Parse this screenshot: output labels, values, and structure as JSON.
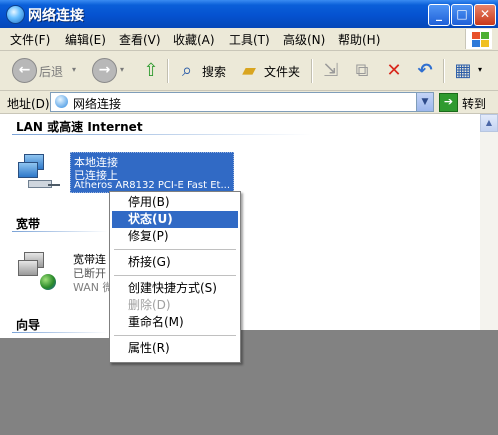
{
  "window": {
    "title": "网络连接"
  },
  "menu": [
    "文件(F)",
    "编辑(E)",
    "查看(V)",
    "收藏(A)",
    "工具(T)",
    "高级(N)",
    "帮助(H)"
  ],
  "toolbar": {
    "back": "后退",
    "search": "搜索",
    "folders": "文件夹"
  },
  "address": {
    "label": "地址(D)",
    "value": "网络连接",
    "go": "转到"
  },
  "groups": {
    "lan": {
      "header": "LAN 或高速 Internet"
    },
    "broadband": {
      "header": "宽带"
    },
    "wizard": {
      "header": "向导"
    }
  },
  "connections": {
    "lan": {
      "name": "本地连接",
      "status": "已连接上",
      "device": "Atheros AR8132 PCI-E Fast Et..."
    },
    "broadband": {
      "name": "宽带连",
      "status": "已断开",
      "device": "WAN 微"
    }
  },
  "context_menu": {
    "items": [
      {
        "label": "停用(B)",
        "state": "normal"
      },
      {
        "label": "状态(U)",
        "state": "selected"
      },
      {
        "label": "修复(P)",
        "state": "normal"
      },
      {
        "label": "桥接(G)",
        "state": "normal"
      },
      {
        "label": "创建快捷方式(S)",
        "state": "normal"
      },
      {
        "label": "删除(D)",
        "state": "disabled"
      },
      {
        "label": "重命名(M)",
        "state": "normal"
      },
      {
        "label": "属性(R)",
        "state": "normal"
      }
    ]
  },
  "icons": [
    "network-connections-icon",
    "back-arrow-icon",
    "forward-arrow-icon",
    "up-folder-icon",
    "search-icon",
    "folders-icon",
    "move-to-icon",
    "copy-to-icon",
    "delete-icon",
    "undo-icon",
    "views-icon",
    "go-arrow-icon",
    "lan-connection-icon",
    "broadband-connection-icon"
  ],
  "colors": {
    "titlebar": "#0552d0",
    "selection": "#316ac5",
    "chrome": "#ece9d8",
    "overlay": "#828282"
  }
}
